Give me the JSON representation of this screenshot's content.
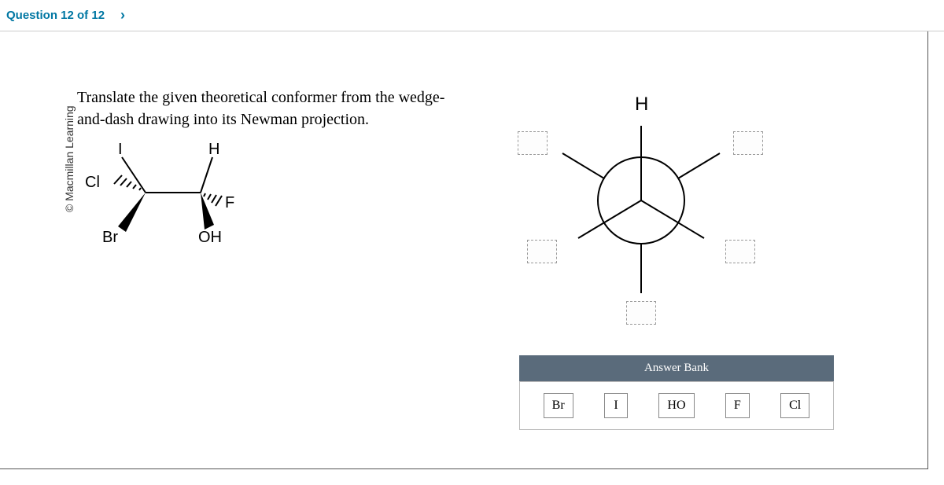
{
  "header": {
    "question_label": "Question 12 of 12",
    "next_glyph": "›"
  },
  "copyright": "© Macmillan Learning",
  "prompt": "Translate the given theoretical conformer from the wedge-and-dash drawing into its Newman projection.",
  "wedge": {
    "labels": {
      "I": "I",
      "Cl": "Cl",
      "Br": "Br",
      "H": "H",
      "F": "F",
      "OH": "OH"
    }
  },
  "newman": {
    "fixed_label": "H"
  },
  "answer_bank": {
    "title": "Answer Bank",
    "items": [
      "Br",
      "I",
      "HO",
      "F",
      "Cl"
    ]
  }
}
